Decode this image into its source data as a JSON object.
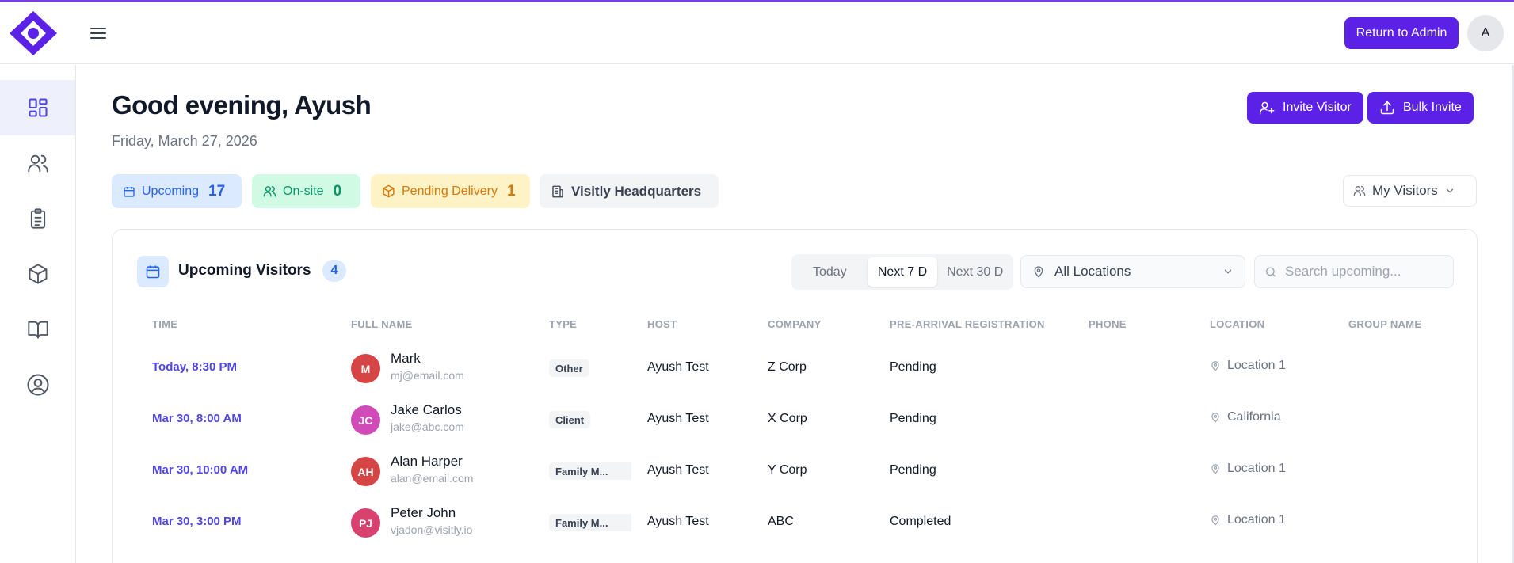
{
  "header": {
    "return_label": "Return to Admin",
    "avatar_initial": "A"
  },
  "sidebar": {
    "items": [
      {
        "icon": "dashboard-icon",
        "active": true
      },
      {
        "icon": "users-icon",
        "active": false
      },
      {
        "icon": "clipboard-icon",
        "active": false
      },
      {
        "icon": "package-icon",
        "active": false
      },
      {
        "icon": "book-icon",
        "active": false
      },
      {
        "icon": "user-circle-icon",
        "active": false
      }
    ]
  },
  "main": {
    "greeting": "Good evening, Ayush",
    "date": "Friday, March 27, 2026",
    "invite_label": "Invite Visitor",
    "bulk_invite_label": "Bulk Invite",
    "stats": {
      "upcoming_label": "Upcoming",
      "upcoming_count": "17",
      "onsite_label": "On-site",
      "onsite_count": "0",
      "pending_label": "Pending Delivery",
      "pending_count": "1",
      "site_name": "Visitly Headquarters"
    },
    "filter_label": "My Visitors"
  },
  "card": {
    "title": "Upcoming Visitors",
    "count": "4",
    "ranges": [
      "Today",
      "Next 7 D",
      "Next 30 D"
    ],
    "active_range": "Next 7 D",
    "location_value": "All Locations",
    "search_placeholder": "Search upcoming...",
    "columns": [
      "TIME",
      "FULL NAME",
      "TYPE",
      "HOST",
      "COMPANY",
      "PRE-ARRIVAL REGISTRATION",
      "PHONE",
      "LOCATION",
      "GROUP NAME"
    ],
    "rows": [
      {
        "time": "Today, 8:30 PM",
        "initials": "M",
        "avatar_color": "#d64545",
        "name": "Mark",
        "email": "mj@email.com",
        "type": "Other",
        "host": "Ayush Test",
        "company": "Z Corp",
        "prereg": "Pending",
        "phone": "",
        "location": "Location 1",
        "group": ""
      },
      {
        "time": "Mar 30, 8:00 AM",
        "initials": "JC",
        "avatar_color": "#d04bb8",
        "name": "Jake Carlos",
        "email": "jake@abc.com",
        "type": "Client",
        "host": "Ayush Test",
        "company": "X Corp",
        "prereg": "Pending",
        "phone": "",
        "location": "California",
        "group": ""
      },
      {
        "time": "Mar 30, 10:00 AM",
        "initials": "AH",
        "avatar_color": "#d64545",
        "name": "Alan Harper",
        "email": "alan@email.com",
        "type": "Family M...",
        "host": "Ayush Test",
        "company": "Y Corp",
        "prereg": "Pending",
        "phone": "",
        "location": "Location 1",
        "group": ""
      },
      {
        "time": "Mar 30, 3:00 PM",
        "initials": "PJ",
        "avatar_color": "#d9416e",
        "name": "Peter John",
        "email": "vjadon@visitly.io",
        "type": "Family M...",
        "host": "Ayush Test",
        "company": "ABC",
        "prereg": "Completed",
        "phone": "",
        "location": "Location 1",
        "group": ""
      }
    ]
  }
}
